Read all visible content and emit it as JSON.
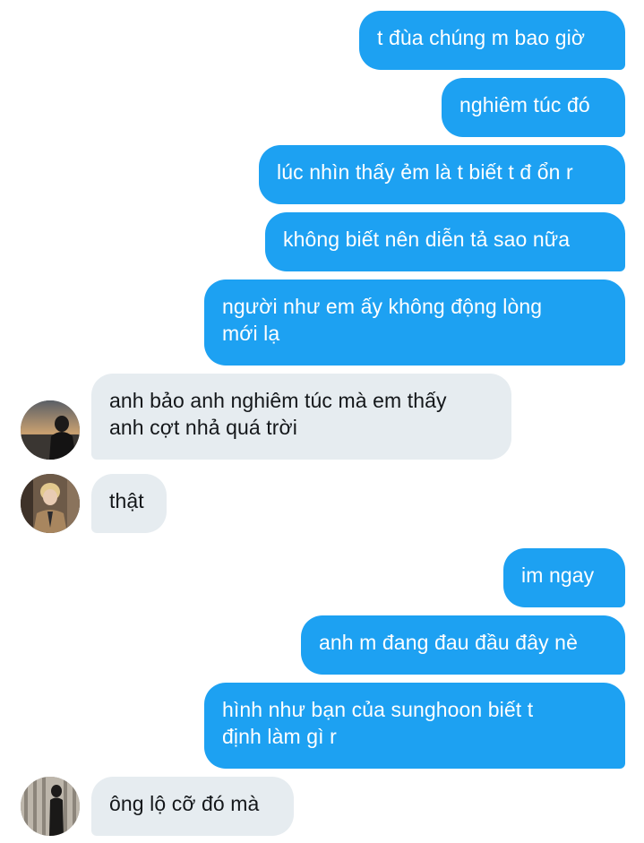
{
  "conversation": {
    "messages": [
      {
        "dir": "out",
        "text": "t đùa chúng m bao giờ"
      },
      {
        "dir": "out",
        "text": "nghiêm túc đó"
      },
      {
        "dir": "out",
        "text": "lúc nhìn thấy ẻm là t biết t đ ổn r"
      },
      {
        "dir": "out",
        "text": "không biết nên diễn tả sao nữa"
      },
      {
        "dir": "out",
        "lines": [
          "người như em ấy không động lòng",
          "mới lạ"
        ]
      },
      {
        "dir": "in",
        "lines": [
          "anh bảo anh nghiêm túc mà em thấy",
          "anh cợt nhả quá trời"
        ],
        "avatar": "avatar-sunset"
      },
      {
        "dir": "in",
        "text": "thật",
        "avatar": "avatar-blond"
      },
      {
        "dir": "out",
        "text": "im ngay"
      },
      {
        "dir": "out",
        "text": "anh m đang đau đầu đây nè"
      },
      {
        "dir": "out",
        "lines": [
          "hình như bạn của sunghoon biết t",
          "định làm gì r"
        ]
      },
      {
        "dir": "in",
        "text": "ông lộ cỡ đó mà",
        "avatar": "avatar-window"
      }
    ]
  },
  "colors": {
    "outgoing": "#1da1f2",
    "incoming": "#e6ecf0",
    "incoming_text": "#14171a"
  }
}
